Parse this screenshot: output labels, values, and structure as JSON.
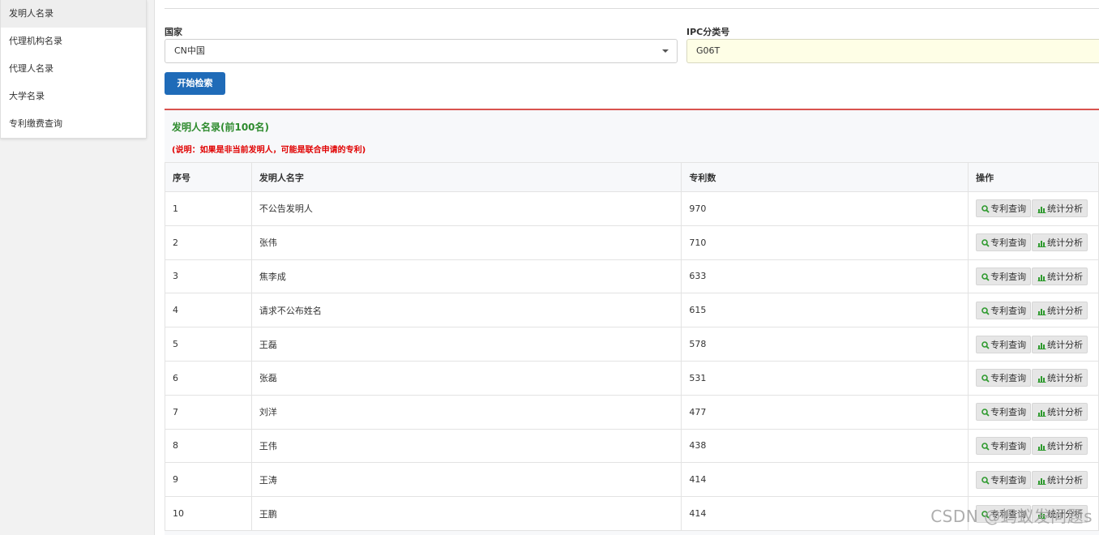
{
  "sidebar": {
    "items": [
      {
        "label": "发明人名录",
        "active": true
      },
      {
        "label": "代理机构名录",
        "active": false
      },
      {
        "label": "代理人名录",
        "active": false
      },
      {
        "label": "大学名录",
        "active": false
      },
      {
        "label": "专利缴费查询",
        "active": false
      }
    ]
  },
  "form": {
    "country_label": "国家",
    "country_value": "CN中国",
    "ipc_label": "IPC分类号",
    "ipc_value": "G06T",
    "search_button": "开始检索"
  },
  "panel": {
    "title": "发明人名录(前100名)",
    "note": "(说明：如果是非当前发明人，可能是联合申请的专利)"
  },
  "table": {
    "headers": [
      "序号",
      "发明人名字",
      "专利数",
      "操作"
    ],
    "rows": [
      {
        "no": "1",
        "name": "不公告发明人",
        "count": "970"
      },
      {
        "no": "2",
        "name": "张伟",
        "count": "710"
      },
      {
        "no": "3",
        "name": "焦李成",
        "count": "633"
      },
      {
        "no": "4",
        "name": "请求不公布姓名",
        "count": "615"
      },
      {
        "no": "5",
        "name": "王磊",
        "count": "578"
      },
      {
        "no": "6",
        "name": "张磊",
        "count": "531"
      },
      {
        "no": "7",
        "name": "刘洋",
        "count": "477"
      },
      {
        "no": "8",
        "name": "王伟",
        "count": "438"
      },
      {
        "no": "9",
        "name": "王涛",
        "count": "414"
      },
      {
        "no": "10",
        "name": "王鹏",
        "count": "414"
      }
    ],
    "action_search": "专利查询",
    "action_stats": "统计分析"
  },
  "watermark": "CSDN @蚂蚁发问题s",
  "colors": {
    "primary_button": "#1f6bb8",
    "panel_border": "#d9534f",
    "title_green": "#2e8b2e",
    "note_red": "#e00000",
    "ipc_bg": "#fefee6"
  },
  "icons": {
    "search": "magnifier-icon",
    "stats": "bar-chart-icon",
    "select": "caret-down-icon"
  }
}
